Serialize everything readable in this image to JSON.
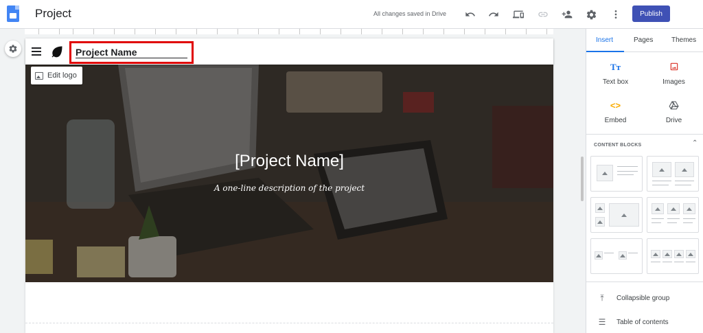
{
  "topbar": {
    "title": "Project",
    "save_status": "All changes saved in Drive",
    "publish_label": "Publish",
    "icons": [
      "undo-icon",
      "redo-icon",
      "preview-icon",
      "link-icon",
      "share-icon",
      "settings-icon",
      "more-vert-icon"
    ]
  },
  "site": {
    "name": "Project Name",
    "edit_logo_label": "Edit logo",
    "hero_title": "[Project Name]",
    "hero_subtitle": "A one-line description of the project"
  },
  "panel": {
    "tabs": [
      "Insert",
      "Pages",
      "Themes"
    ],
    "active_tab": "Insert",
    "insert_items": [
      {
        "label": "Text box",
        "icon": "text-box-icon"
      },
      {
        "label": "Images",
        "icon": "images-icon"
      },
      {
        "label": "Embed",
        "icon": "embed-icon"
      },
      {
        "label": "Drive",
        "icon": "drive-icon"
      }
    ],
    "content_blocks_label": "CONTENT BLOCKS",
    "bottom_items": [
      {
        "label": "Collapsible group",
        "icon": "collapsible-icon"
      },
      {
        "label": "Table of contents",
        "icon": "toc-icon"
      }
    ]
  },
  "colors": {
    "accent": "#1a73e8",
    "publish": "#3f51b5",
    "highlight": "#e00000",
    "images_icon": "#d93025",
    "embed_icon": "#f9ab00"
  }
}
